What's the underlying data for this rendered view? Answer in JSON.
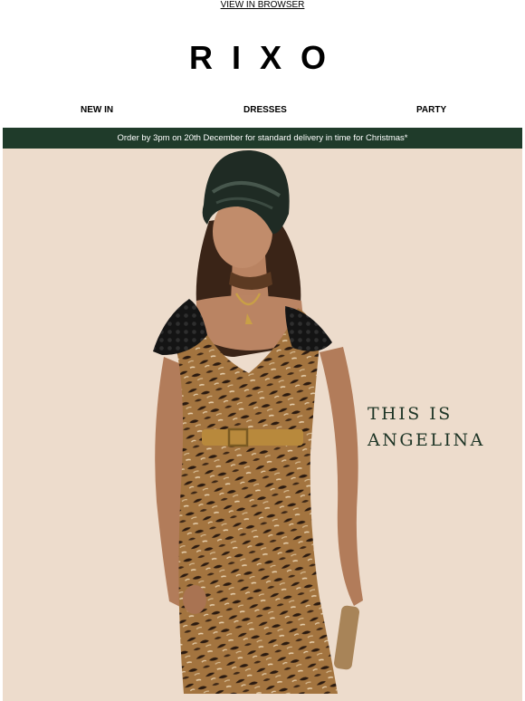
{
  "header": {
    "view_in_browser": "VIEW IN BROWSER",
    "logo": "RIXO"
  },
  "nav": {
    "items": [
      "NEW IN",
      "DRESSES",
      "PARTY"
    ]
  },
  "banner": {
    "text": "Order by 3pm on 20th December for standard delivery in time for Christmas*"
  },
  "hero": {
    "headline_line1": "THIS IS",
    "headline_line2": "ANGELINA",
    "colors": {
      "background": "#eddccc",
      "banner": "#1f3b2a",
      "headline": "#1e3526"
    }
  }
}
